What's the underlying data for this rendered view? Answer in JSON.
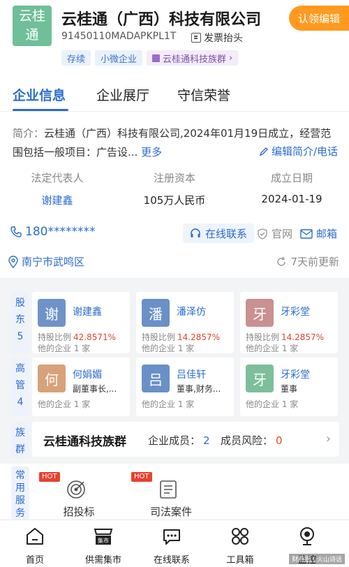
{
  "header": {
    "logo_line1": "云桂",
    "logo_line2": "通",
    "company_name": "云桂通（广西）科技有限公司",
    "claim_label": "认领编辑",
    "credit_code": "91450110MADAPKPL1T",
    "invoice_label": "发票抬头",
    "tags": [
      "存续",
      "小微企业",
      "云桂通科技族群"
    ]
  },
  "tabs": [
    "企业信息",
    "企业展厅",
    "守信荣誉"
  ],
  "intro": {
    "label": "简介：",
    "text": "云桂通（广西）科技有限公司,2024年01月19日成立，经营范围包括一般项目：广告设...",
    "more": "更多",
    "edit_label": "编辑简介/电话"
  },
  "key_info": [
    {
      "label": "法定代表人",
      "value": "谢建鑫"
    },
    {
      "label": "注册资本",
      "value": "105万人民币"
    },
    {
      "label": "成立日期",
      "value": "2024-01-19"
    }
  ],
  "contact": {
    "phone": "180********",
    "online_label": "在线联系",
    "official_label": "官网",
    "mailbox_label": "邮箱",
    "address": "南宁市武鸣区",
    "updated": "7天前更新"
  },
  "shareholders": {
    "side_label": [
      "股",
      "东",
      "5"
    ],
    "items": [
      {
        "avatar": "谢",
        "name": "谢建鑫",
        "ratio_label": "持股比例",
        "ratio": "42.8571%",
        "other": "他的企业 1 家",
        "color": "#6f93c9"
      },
      {
        "avatar": "潘",
        "name": "潘泽仿",
        "ratio_label": "持股比例",
        "ratio": "14.2857%",
        "other": "他的企业 1 家",
        "color": "#6a90c8"
      },
      {
        "avatar": "牙",
        "name": "牙彩堂",
        "ratio_label": "持股比例",
        "ratio": "14.2857%",
        "other": "他的企业 1 家",
        "color": "#c99190"
      }
    ]
  },
  "executives": {
    "side_label": [
      "高",
      "管",
      "4"
    ],
    "items": [
      {
        "avatar": "何",
        "name": "何娟媚",
        "role": "副董事长,...",
        "other": "他的企业 1 家",
        "color": "#d7a27a"
      },
      {
        "avatar": "吕",
        "name": "吕佳轩",
        "role": "董事,财务...",
        "other": "他的企业 1 家",
        "color": "#6a90c8"
      },
      {
        "avatar": "牙",
        "name": "牙彩堂",
        "role": "董事",
        "other": "他的企业 1 家",
        "color": "#7dbf9a"
      }
    ]
  },
  "group": {
    "side_label": [
      "族",
      "群"
    ],
    "title": "云桂通科技族群",
    "members_label": "企业成员：",
    "members": "2",
    "risk_label": "成员风险：",
    "risk": "0"
  },
  "services": {
    "side_label": [
      "常",
      "用",
      "服",
      "务"
    ],
    "items": [
      {
        "hot": "HOT",
        "label": "招投标"
      },
      {
        "hot": "HOT",
        "label": "司法案件"
      }
    ]
  },
  "bottom_nav": [
    {
      "label": "首页",
      "icon": "home-icon"
    },
    {
      "label": "供需集市",
      "icon": "market-icon",
      "badge": "集市"
    },
    {
      "label": "在线联系",
      "icon": "chat-icon"
    },
    {
      "label": "工具箱",
      "icon": "toolbox-icon"
    },
    {
      "label": "监控",
      "icon": "monitor-icon"
    }
  ],
  "watermark": "财商圈 | 火山诗话"
}
